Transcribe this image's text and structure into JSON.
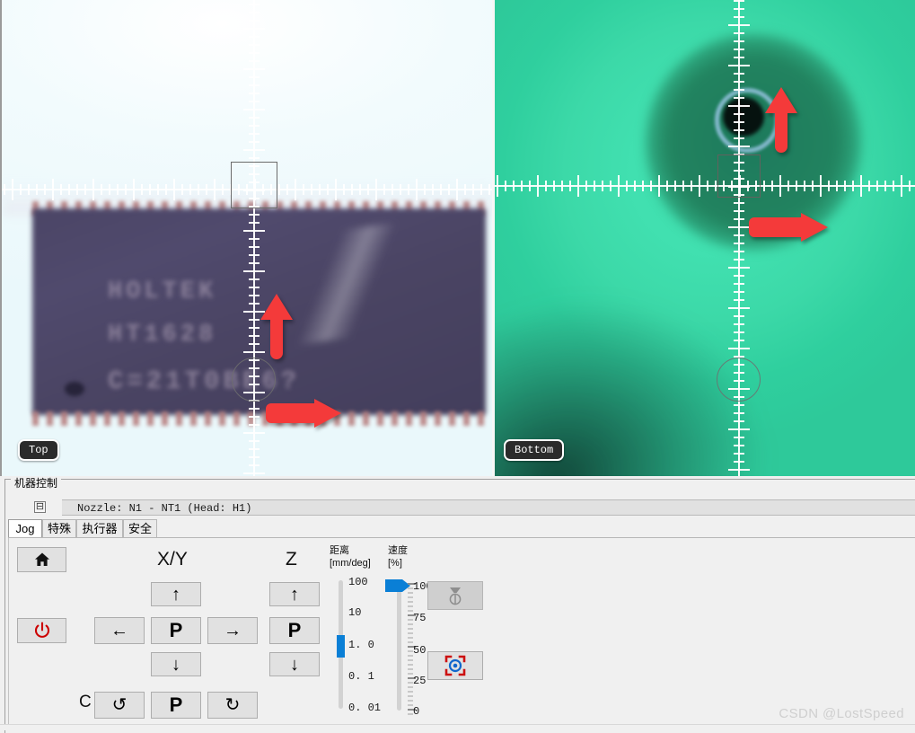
{
  "cameras": {
    "top": {
      "label": "Top",
      "scene": "blurred-soic-chip",
      "chip_lines": [
        "HOLTEK",
        "HT1628",
        "C=21T0BE6?"
      ]
    },
    "bottom": {
      "label": "Bottom",
      "scene": "green-nozzle-backlight"
    }
  },
  "panel": {
    "group_title": "机器控制",
    "collapse_glyph": "⊟",
    "nozzle_text": "Nozzle: N1 - NT1 (Head: H1)",
    "tabs": [
      {
        "label": "Jog",
        "active": true
      },
      {
        "label": "特殊",
        "active": false
      },
      {
        "label": "执行器",
        "active": false
      },
      {
        "label": "安全",
        "active": false
      }
    ]
  },
  "jog": {
    "home_glyph": "⌂",
    "power_glyph": "⏻",
    "xy_label": "X/Y",
    "z_label": "Z",
    "c_label": "C",
    "park_label": "P",
    "up_glyph": "↑",
    "down_glyph": "↓",
    "left_glyph": "←",
    "right_glyph": "→",
    "ccw_glyph": "↺",
    "cw_glyph": "↻"
  },
  "sliders": {
    "distance": {
      "title": "距离",
      "unit": "[mm/deg]",
      "ticks": [
        "100",
        "10",
        "1. 0",
        "0. 1",
        "0. 01"
      ],
      "value": "1. 0"
    },
    "speed": {
      "title": "速度",
      "unit": "[%]",
      "ticks": [
        "100",
        "75",
        "50",
        "25",
        "0"
      ],
      "value": "100"
    }
  },
  "side_buttons": [
    {
      "name": "nozzle-vacuum-button",
      "enabled": false
    },
    {
      "name": "camera-target-button",
      "enabled": true
    }
  ],
  "watermark": "CSDN @LostSpeed",
  "colors": {
    "accent_blue": "#0a7fd6",
    "arrow_red": "#f43a3a",
    "power_red": "#cc0000",
    "panel_bg": "#f0f0f0",
    "button_bg": "#e1e1e1"
  }
}
